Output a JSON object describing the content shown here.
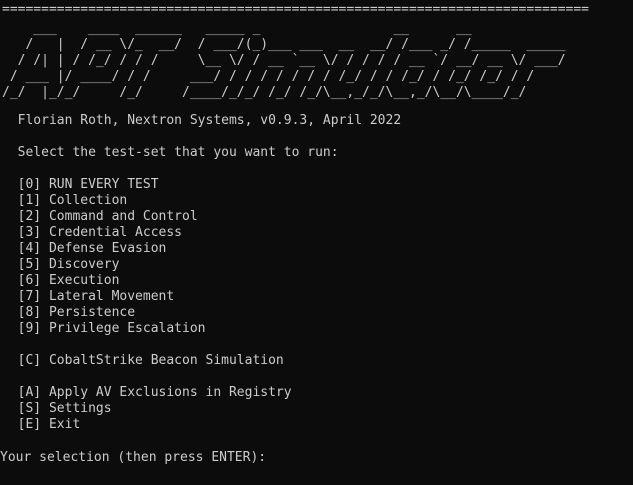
{
  "separator": "===========================================================================",
  "banner": [
    "    ___    ____  ______   _____ _                 __      __",
    "   /   |  / __ \\/_  __/  / ___/(_)___ ___  __  __/ /___ _/ /_____  _____",
    "  / /| | / /_/ / / /     \\__ \\/ / __ `__ \\/ / / / / __ `/ __/ __ \\/ ___/",
    " / ___ |/ ____/ / /     ___/ / / / / / / / /_/ / / /_/ / /_/ /_/ / /",
    "/_/  |_/_/     /_/     /____/_/_/ /_/ /_/\\__,_/_/\\__,_/\\__/\\____/_/"
  ],
  "author_line": "  Florian Roth, Nextron Systems, v0.9.3, April 2022",
  "prompt_header": "  Select the test-set that you want to run:",
  "menu": {
    "tests": [
      "  [0] RUN EVERY TEST",
      "  [1] Collection",
      "  [2] Command and Control",
      "  [3] Credential Access",
      "  [4] Defense Evasion",
      "  [5] Discovery",
      "  [6] Execution",
      "  [7] Lateral Movement",
      "  [8] Persistence",
      "  [9] Privilege Escalation"
    ],
    "cobalt": "  [C] CobaltStrike Beacon Simulation",
    "extras": [
      "  [A] Apply AV Exclusions in Registry",
      "  [S] Settings",
      "  [E] Exit"
    ]
  },
  "input_prompt": "Your selection (then press ENTER): ",
  "colors": {
    "background": "#0c0c0c",
    "foreground": "#cccccc"
  }
}
